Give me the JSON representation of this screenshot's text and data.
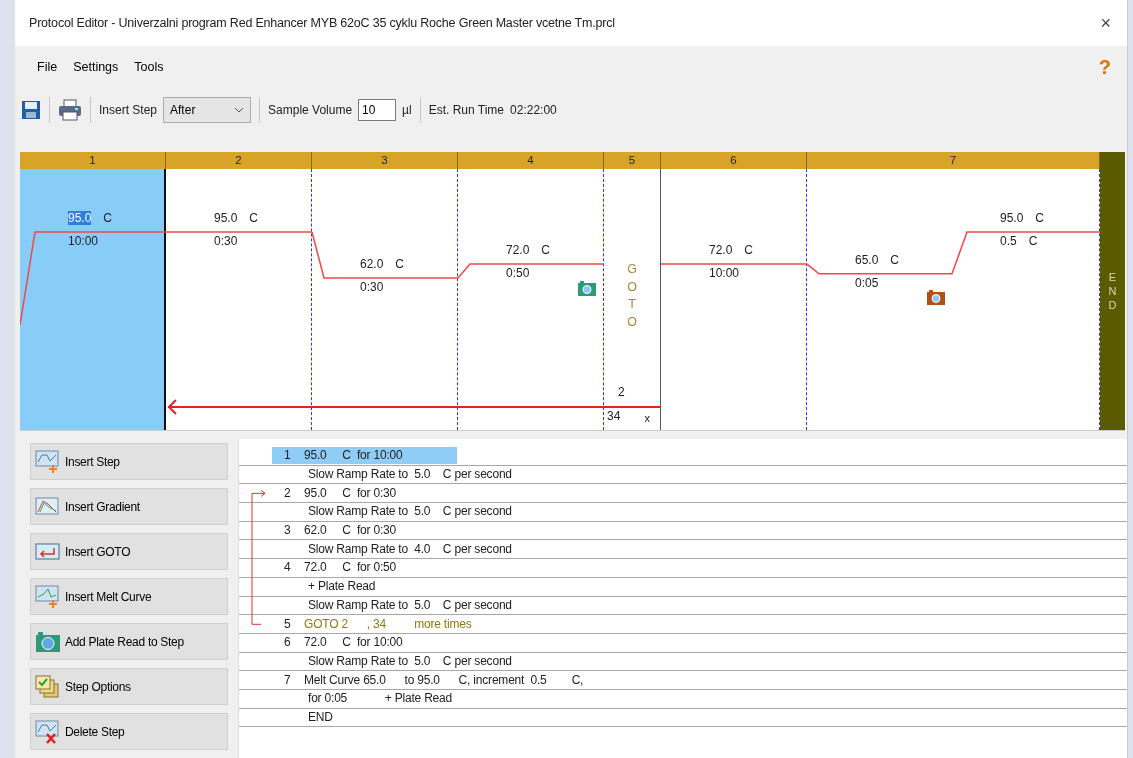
{
  "window": {
    "title": "Protocol Editor - Univerzalni program Red Enhancer MYB 62oC 35 cyklu Roche Green Master vcetne Tm.prcl",
    "close": "×"
  },
  "menu": [
    "File",
    "Settings",
    "Tools"
  ],
  "help": "?",
  "toolbar": {
    "insert_step_label": "Insert Step",
    "insert_step_value": "After",
    "sample_volume_label": "Sample Volume",
    "sample_volume": "10",
    "sample_volume_unit": "µl",
    "run_time_label": "Est. Run Time",
    "run_time": "02:22:00"
  },
  "protocol_graph": {
    "steps": [
      {
        "number": "1",
        "kind": "step",
        "selected": true,
        "temp": "95.0",
        "unit": "C",
        "time": "10:00",
        "plate_read": false
      },
      {
        "number": "2",
        "kind": "step",
        "selected": false,
        "temp": "95.0",
        "unit": "C",
        "time": "0:30",
        "plate_read": false
      },
      {
        "number": "3",
        "kind": "step",
        "selected": false,
        "temp": "62.0",
        "unit": "C",
        "time": "0:30",
        "plate_read": false
      },
      {
        "number": "4",
        "kind": "step",
        "selected": false,
        "temp": "72.0",
        "unit": "C",
        "time": "0:50",
        "plate_read": true
      },
      {
        "number": "5",
        "kind": "goto",
        "selected": false,
        "label": "GOTO",
        "target": "2",
        "repeats": "34",
        "times_mark": "x"
      },
      {
        "number": "6",
        "kind": "step",
        "selected": false,
        "temp": "72.0",
        "unit": "C",
        "time": "10:00",
        "plate_read": false
      },
      {
        "number": "7",
        "kind": "melt",
        "selected": false,
        "start_temp": "65.0",
        "unit": "C",
        "hold": "0:05",
        "end_temp": "95.0",
        "end_unit": "C",
        "increment": "0.5",
        "increment_unit": "C",
        "plate_read": true
      }
    ],
    "end_label": "END"
  },
  "actions": [
    "Insert Step",
    "Insert Gradient",
    "Insert GOTO",
    "Insert Melt Curve",
    "Add Plate Read to Step",
    "Step Options",
    "Delete Step"
  ],
  "listing": [
    {
      "kind": "step",
      "number": "1",
      "text": "95.0     C  for 10:00",
      "selected": true
    },
    {
      "kind": "detail",
      "text": "Slow Ramp Rate to  5.0    C per second",
      "selected": false
    },
    {
      "kind": "step",
      "number": "2",
      "text": "95.0     C  for 0:30",
      "selected": false
    },
    {
      "kind": "detail",
      "text": "Slow Ramp Rate to  5.0    C per second",
      "selected": false
    },
    {
      "kind": "step",
      "number": "3",
      "text": "62.0     C  for 0:30",
      "selected": false
    },
    {
      "kind": "detail",
      "text": "Slow Ramp Rate to  4.0    C per second",
      "selected": false
    },
    {
      "kind": "step",
      "number": "4",
      "text": "72.0     C  for 0:50",
      "selected": false
    },
    {
      "kind": "detail",
      "text": "+ Plate Read",
      "selected": false
    },
    {
      "kind": "detail",
      "text": "Slow Ramp Rate to  5.0    C per second",
      "selected": false
    },
    {
      "kind": "goto",
      "number": "5",
      "text": "GOTO 2      , 34         more times",
      "selected": false
    },
    {
      "kind": "step",
      "number": "6",
      "text": "72.0     C  for 10:00",
      "selected": false
    },
    {
      "kind": "detail",
      "text": "Slow Ramp Rate to  5.0    C per second",
      "selected": false
    },
    {
      "kind": "step",
      "number": "7",
      "text": "Melt Curve 65.0      to 95.0      C, increment  0.5        C,",
      "selected": false
    },
    {
      "kind": "detail",
      "text": "for 0:05            + Plate Read",
      "selected": false
    },
    {
      "kind": "detail",
      "text": "END",
      "selected": false
    }
  ]
}
